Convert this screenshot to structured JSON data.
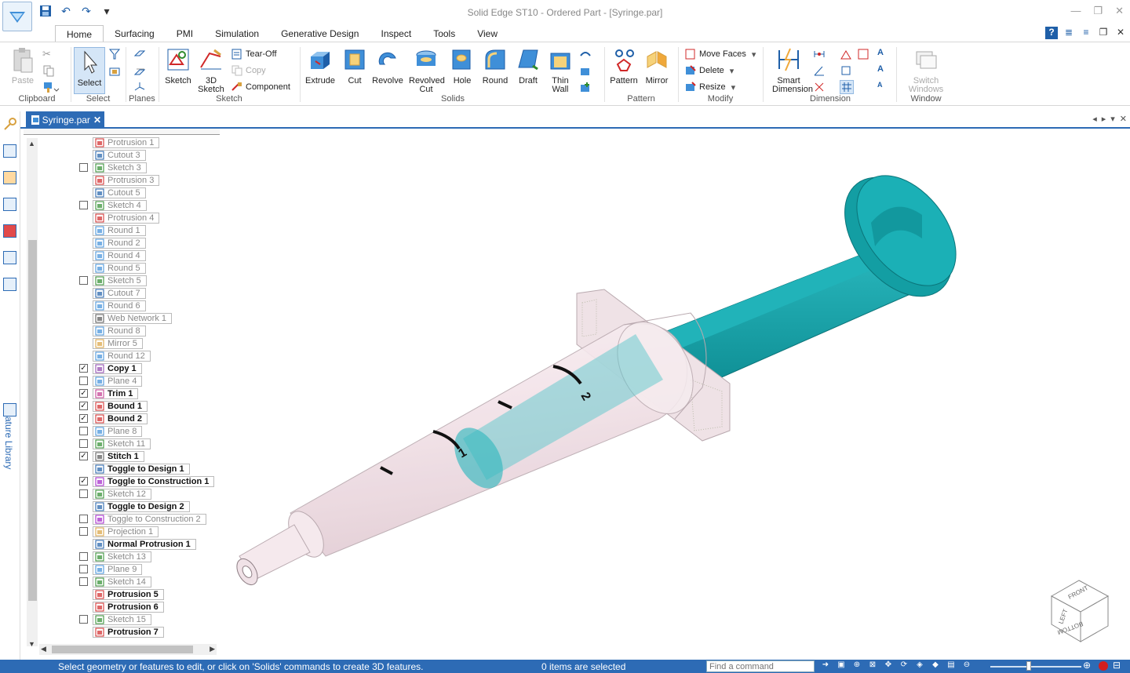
{
  "window": {
    "title": "Solid Edge ST10 - Ordered Part - [Syringe.par]"
  },
  "quick_access": [
    "save-icon",
    "undo-icon",
    "redo-icon",
    "customize-icon"
  ],
  "ribbon_tabs": [
    {
      "label": "Home",
      "active": true
    },
    {
      "label": "Surfacing"
    },
    {
      "label": "PMI"
    },
    {
      "label": "Simulation"
    },
    {
      "label": "Generative Design"
    },
    {
      "label": "Inspect"
    },
    {
      "label": "Tools"
    },
    {
      "label": "View"
    }
  ],
  "ribbon": {
    "clipboard": {
      "label": "Clipboard",
      "paste": "Paste"
    },
    "select": {
      "label": "Select",
      "select": "Select"
    },
    "planes": {
      "label": "Planes"
    },
    "sketch": {
      "label": "Sketch",
      "sketch": "Sketch",
      "sketch3d_a": "3D",
      "sketch3d_b": "Sketch",
      "tearoff": "Tear-Off",
      "copy": "Copy",
      "component": "Component"
    },
    "solids": {
      "label": "Solids",
      "extrude": "Extrude",
      "cut": "Cut",
      "revolve": "Revolve",
      "revolved_cut_a": "Revolved",
      "revolved_cut_b": "Cut",
      "hole": "Hole",
      "round": "Round",
      "draft": "Draft",
      "thin_wall_a": "Thin",
      "thin_wall_b": "Wall"
    },
    "pattern": {
      "label": "Pattern",
      "pattern": "Pattern",
      "mirror": "Mirror"
    },
    "modify": {
      "label": "Modify",
      "move_faces": "Move Faces",
      "delete": "Delete",
      "resize": "Resize"
    },
    "dimension": {
      "label": "Dimension",
      "smart_a": "Smart",
      "smart_b": "Dimension"
    },
    "window": {
      "label": "Window",
      "switch_a": "Switch",
      "switch_b": "Windows"
    }
  },
  "document_tab": {
    "label": "Syringe.par"
  },
  "left_panel": {
    "feature_library": "Feature Library"
  },
  "pathfinder": [
    {
      "label": "Protrusion 1",
      "check": null,
      "active": false,
      "icon": "protrusion"
    },
    {
      "label": "Cutout 3",
      "check": null,
      "active": false,
      "icon": "cutout"
    },
    {
      "label": "Sketch 3",
      "check": false,
      "active": false,
      "icon": "sketch"
    },
    {
      "label": "Protrusion 3",
      "check": null,
      "active": false,
      "icon": "protrusion"
    },
    {
      "label": "Cutout 5",
      "check": null,
      "active": false,
      "icon": "cutout"
    },
    {
      "label": "Sketch 4",
      "check": false,
      "active": false,
      "icon": "sketch"
    },
    {
      "label": "Protrusion 4",
      "check": null,
      "active": false,
      "icon": "protrusion"
    },
    {
      "label": "Round 1",
      "check": null,
      "active": false,
      "icon": "round"
    },
    {
      "label": "Round 2",
      "check": null,
      "active": false,
      "icon": "round"
    },
    {
      "label": "Round 4",
      "check": null,
      "active": false,
      "icon": "round"
    },
    {
      "label": "Round 5",
      "check": null,
      "active": false,
      "icon": "round"
    },
    {
      "label": "Sketch 5",
      "check": false,
      "active": false,
      "icon": "sketch"
    },
    {
      "label": "Cutout 7",
      "check": null,
      "active": false,
      "icon": "cutout"
    },
    {
      "label": "Round 6",
      "check": null,
      "active": false,
      "icon": "round"
    },
    {
      "label": "Web Network 1",
      "check": null,
      "active": false,
      "icon": "web"
    },
    {
      "label": "Round 8",
      "check": null,
      "active": false,
      "icon": "round"
    },
    {
      "label": "Mirror 5",
      "check": null,
      "active": false,
      "icon": "mirror"
    },
    {
      "label": "Round 12",
      "check": null,
      "active": false,
      "icon": "round"
    },
    {
      "label": "Copy 1",
      "check": true,
      "active": true,
      "icon": "copy"
    },
    {
      "label": "Plane 4",
      "check": false,
      "active": false,
      "icon": "plane"
    },
    {
      "label": "Trim 1",
      "check": true,
      "active": true,
      "icon": "trim"
    },
    {
      "label": "Bound 1",
      "check": true,
      "active": true,
      "icon": "bound"
    },
    {
      "label": "Bound 2",
      "check": true,
      "active": true,
      "icon": "bound"
    },
    {
      "label": "Plane 8",
      "check": false,
      "active": false,
      "icon": "plane"
    },
    {
      "label": "Sketch 11",
      "check": false,
      "active": false,
      "icon": "sketch"
    },
    {
      "label": "Stitch 1",
      "check": true,
      "active": true,
      "icon": "stitch"
    },
    {
      "label": "Toggle to Design 1",
      "check": null,
      "active": true,
      "icon": "design"
    },
    {
      "label": "Toggle to Construction 1",
      "check": true,
      "active": true,
      "icon": "construction"
    },
    {
      "label": "Sketch 12",
      "check": false,
      "active": false,
      "icon": "sketch"
    },
    {
      "label": "Toggle to Design 2",
      "check": null,
      "active": true,
      "icon": "design"
    },
    {
      "label": "Toggle to Construction 2",
      "check": false,
      "active": false,
      "icon": "construction"
    },
    {
      "label": "Projection 1",
      "check": false,
      "active": false,
      "icon": "projection"
    },
    {
      "label": "Normal Protrusion 1",
      "check": null,
      "active": true,
      "icon": "normal"
    },
    {
      "label": "Sketch 13",
      "check": false,
      "active": false,
      "icon": "sketch"
    },
    {
      "label": "Plane 9",
      "check": false,
      "active": false,
      "icon": "plane"
    },
    {
      "label": "Sketch 14",
      "check": false,
      "active": false,
      "icon": "sketch"
    },
    {
      "label": "Protrusion 5",
      "check": null,
      "active": true,
      "icon": "protrusion"
    },
    {
      "label": "Protrusion 6",
      "check": null,
      "active": true,
      "icon": "protrusion"
    },
    {
      "label": "Sketch 15",
      "check": false,
      "active": false,
      "icon": "sketch"
    },
    {
      "label": "Protrusion 7",
      "check": null,
      "active": true,
      "icon": "protrusion"
    }
  ],
  "viewport": {
    "scale_marks": [
      "1",
      "2"
    ],
    "view_cube": {
      "top": "FRONT",
      "left": "LEFT",
      "bottom": "BOTTOM"
    }
  },
  "status": {
    "message": "Select geometry or features to edit, or click on 'Solids' commands to create 3D features.",
    "selection": "0 items are selected",
    "find_placeholder": "Find a command"
  },
  "colors": {
    "accent": "#2d6bb5",
    "plunger": "#15a3a8",
    "barrel": "#f6e8ec"
  }
}
